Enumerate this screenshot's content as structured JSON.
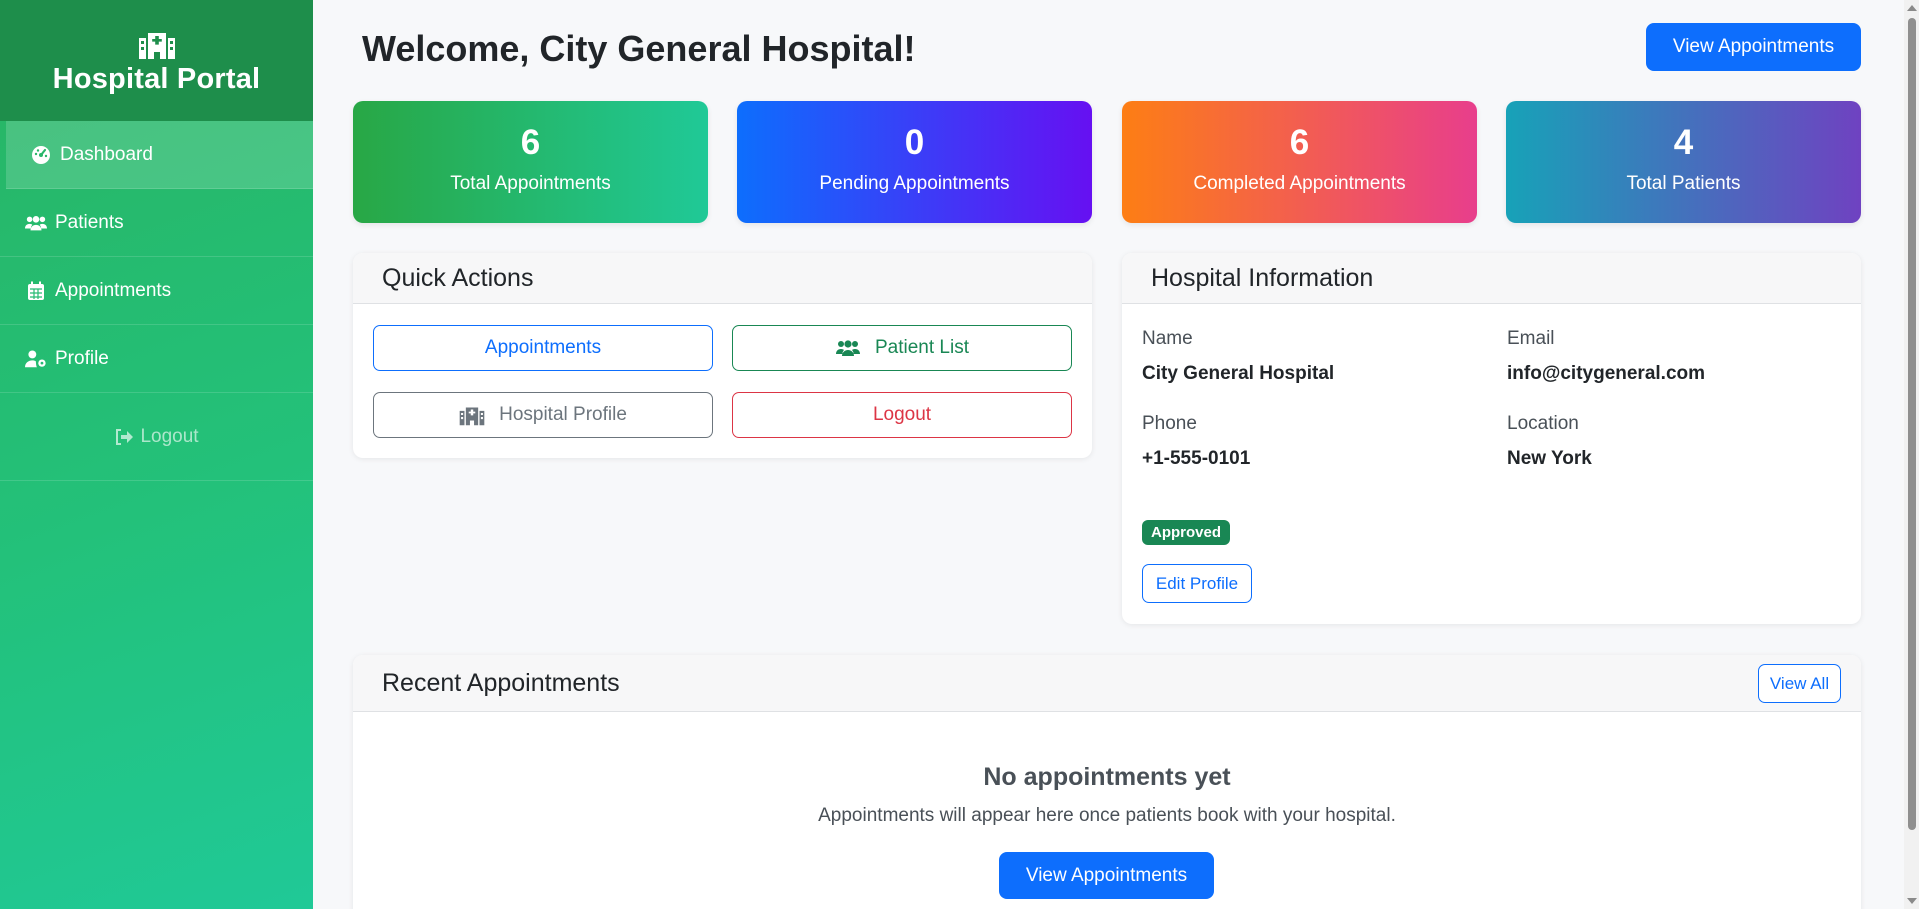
{
  "sidebar": {
    "brand_title": "Hospital Portal",
    "brand_icon": "hospital-icon",
    "items": [
      {
        "label": "Dashboard",
        "icon": "gauge-icon",
        "active": true
      },
      {
        "label": "Patients",
        "icon": "users-icon",
        "active": false
      },
      {
        "label": "Appointments",
        "icon": "calendar-icon",
        "active": false
      },
      {
        "label": "Profile",
        "icon": "user-gear-icon",
        "active": false
      }
    ],
    "logout_label": "Logout"
  },
  "header": {
    "title": "Welcome, City General Hospital!",
    "view_appointments_label": "View Appointments"
  },
  "stats": [
    {
      "value": "6",
      "label": "Total Appointments"
    },
    {
      "value": "0",
      "label": "Pending Appointments"
    },
    {
      "value": "6",
      "label": "Completed Appointments"
    },
    {
      "value": "4",
      "label": "Total Patients"
    }
  ],
  "quick_actions": {
    "title": "Quick Actions",
    "appointments_label": "Appointments",
    "patient_list_label": "Patient List",
    "hospital_profile_label": "Hospital Profile",
    "logout_label": "Logout"
  },
  "hospital_info": {
    "title": "Hospital Information",
    "name_label": "Name",
    "name_value": "City General Hospital",
    "email_label": "Email",
    "email_value": "info@citygeneral.com",
    "phone_label": "Phone",
    "phone_value": "+1-555-0101",
    "location_label": "Location",
    "location_value": "New York",
    "status_badge": "Approved",
    "edit_profile_label": "Edit Profile"
  },
  "recent_appointments": {
    "title": "Recent Appointments",
    "view_all_label": "View All",
    "empty_title": "No appointments yet",
    "empty_text": "Appointments will appear here once patients book with your hospital.",
    "empty_button_label": "View Appointments"
  },
  "colors": {
    "primary": "#0d6efd",
    "success": "#198754",
    "danger": "#dc3545",
    "secondary": "#6c757d",
    "sidebar_green": "#28b463"
  }
}
